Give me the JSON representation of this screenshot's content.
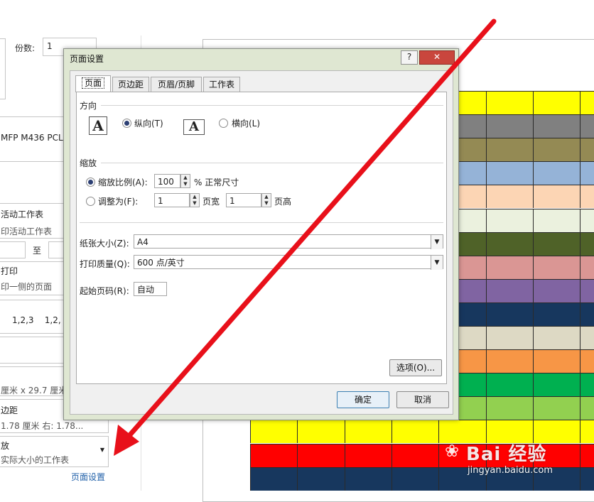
{
  "left_panel": {
    "copies_label": "份数:",
    "copies_value": "1",
    "printer_name": "MFP M436 PCL",
    "print_scope_title": "活动工作表",
    "print_scope_sub": "印活动工作表",
    "pages_to_label": "至",
    "sides_title": "打印",
    "sides_sub": "印一侧的页面",
    "collate_text": "1,2,3    1,2,",
    "collate_prefix": "3",
    "paper_size": "厘米 x 29.7 厘米",
    "margins_title": "边距",
    "margins_sub": "1.78 厘米    右: 1.78...",
    "scaling_title": "放",
    "scaling_sub": "实际大小的工作表",
    "page_setup_link": "页面设置"
  },
  "dialog": {
    "title": "页面设置",
    "help_btn": "?",
    "close_btn": "✕",
    "tabs": [
      {
        "label": "页面",
        "active": true
      },
      {
        "label": "页边距",
        "active": false
      },
      {
        "label": "页眉/页脚",
        "active": false
      },
      {
        "label": "工作表",
        "active": false
      }
    ],
    "orientation": {
      "group_label": "方向",
      "portrait_label": "纵向(T)",
      "landscape_label": "横向(L)",
      "portrait_selected": true,
      "icon_glyph": "A"
    },
    "scaling": {
      "group_label": "缩放",
      "adjust_label": "缩放比例(A):",
      "adjust_value": "100",
      "adjust_suffix": "% 正常尺寸",
      "fit_label": "调整为(F):",
      "fit_wide_value": "1",
      "fit_wide_suffix": "页宽",
      "fit_tall_value": "1",
      "fit_tall_suffix": "页高",
      "adjust_selected": true
    },
    "paper_size_label": "纸张大小(Z):",
    "paper_size_value": "A4",
    "print_quality_label": "打印质量(Q):",
    "print_quality_value": "600 点/英寸",
    "first_page_label": "起始页码(R):",
    "first_page_value": "自动",
    "options_btn": "选项(O)...",
    "ok_btn": "确定",
    "cancel_btn": "取消"
  },
  "preview_rows": [
    "#ffff00",
    "#808080",
    "#948a54",
    "#95b3d7",
    "#fcd5b4",
    "#ebf1de",
    "#4f6228",
    "#da9694",
    "#8064a2",
    "#17375e",
    "#ddd9c4",
    "#f79646",
    "#00b050",
    "#92d050",
    "#ffff00",
    "#ff0000",
    "#17375e"
  ],
  "watermark": {
    "brand": "Bai 经验",
    "url": "jingyan.baidu.com"
  }
}
